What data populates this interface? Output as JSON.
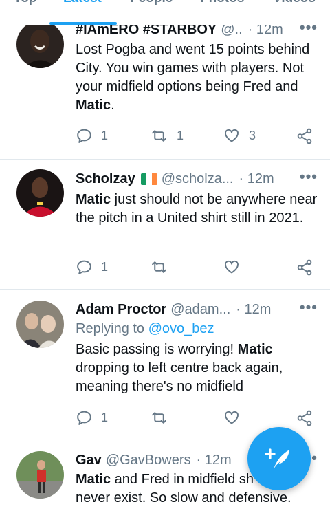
{
  "tabs": [
    {
      "label": "Top"
    },
    {
      "label": "Latest"
    },
    {
      "label": "People"
    },
    {
      "label": "Photos"
    },
    {
      "label": "Videos"
    }
  ],
  "active_tab": "Latest",
  "colors": {
    "accent": "#1da1f2",
    "secondary_text": "#657786",
    "divider": "#e1e8ed"
  },
  "tweets": [
    {
      "name": "#IAmERO #STARBOY",
      "handle": "@..",
      "time": "· 12m",
      "body_parts": [
        "Lost Pogba and went 15 points behind City. You win games with players. Not your midfield options being Fred and ",
        "Matic",
        "."
      ],
      "replies": "1",
      "retweets": "1",
      "likes": "3",
      "more": "•••"
    },
    {
      "name": "Scholzay",
      "flag": "ireland-flag-icon",
      "handle": "@scholza...",
      "time": "· 12m",
      "body_parts": [
        "Matic",
        " just should not be anywhere near the pitch in a United shirt still in 2021."
      ],
      "replies": "1",
      "retweets": "",
      "likes": "",
      "more": "•••"
    },
    {
      "name": "Adam Proctor",
      "handle": "@adam...",
      "time": "· 12m",
      "replying_label": "Replying to ",
      "replying_to": "@ovo_bez",
      "body_parts": [
        "Basic passing is worrying! ",
        "Matic",
        " dropping to left centre back again, meaning there's no midfield"
      ],
      "replies": "1",
      "retweets": "",
      "likes": "",
      "more": "•••"
    },
    {
      "name": "Gav",
      "handle": "@GavBowers",
      "time": "· 12m",
      "body_parts": [
        "Matic",
        " and Fred in midfield sh",
        "never exist. So slow and defensive."
      ],
      "more": "•••"
    }
  ],
  "fab": {
    "icon": "compose-feather-icon"
  }
}
